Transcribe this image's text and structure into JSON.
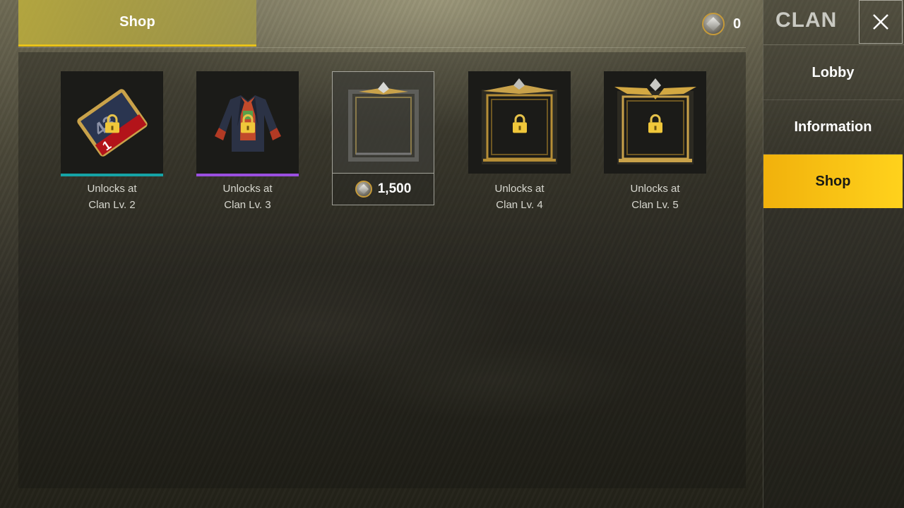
{
  "top_bar": {
    "tab_label": "Shop",
    "currency_value": "0"
  },
  "sidebar": {
    "title": "CLAN",
    "items": [
      {
        "label": "Lobby",
        "active": false
      },
      {
        "label": "Information",
        "active": false
      },
      {
        "label": "Shop",
        "active": true
      }
    ]
  },
  "shop_items": [
    {
      "icon": "rank-card-icon",
      "locked": true,
      "rarity_color": "#15a3a6",
      "caption_line1": "Unlocks at",
      "caption_line2": "Clan Lv. 2"
    },
    {
      "icon": "jacket-outfit-icon",
      "locked": true,
      "rarity_color": "#9a4fe0",
      "caption_line1": "Unlocks at",
      "caption_line2": "Clan Lv. 3"
    },
    {
      "icon": "silver-frame-icon",
      "locked": false,
      "price": "1,500"
    },
    {
      "icon": "gold-frame-icon",
      "locked": true,
      "caption_line1": "Unlocks at",
      "caption_line2": "Clan Lv. 4"
    },
    {
      "icon": "winged-gold-frame-icon",
      "locked": true,
      "caption_line1": "Unlocks at",
      "caption_line2": "Clan Lv. 5"
    }
  ],
  "colors": {
    "accent_yellow": "#f1b10c",
    "tab_underline": "#e8c21a"
  }
}
